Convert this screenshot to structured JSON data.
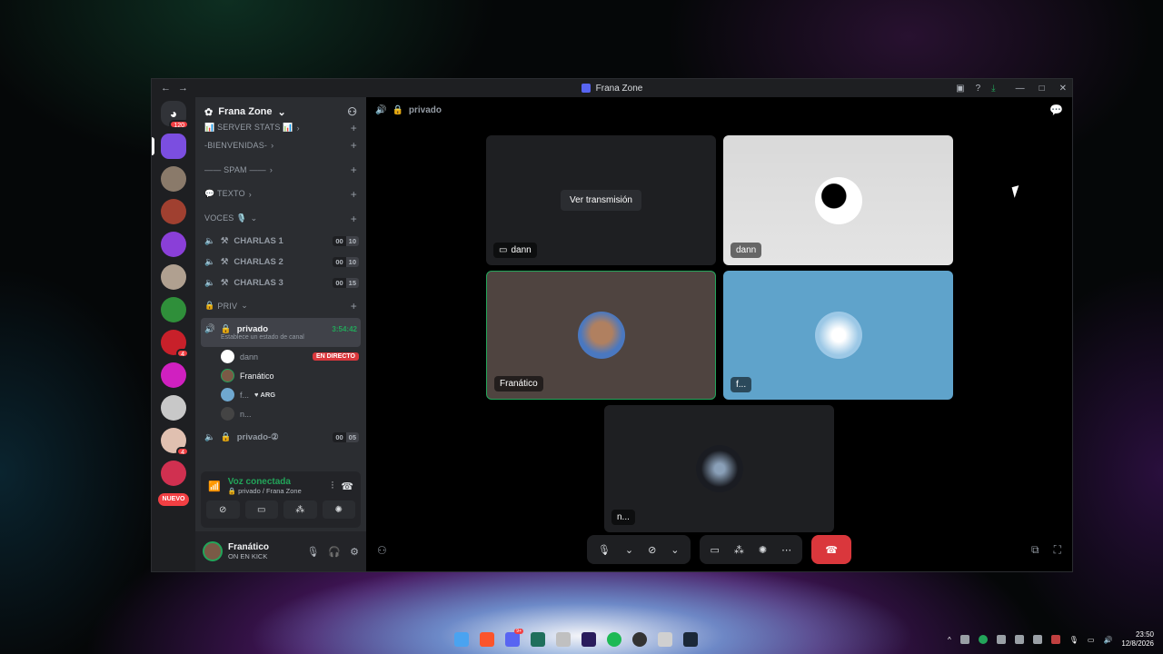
{
  "window": {
    "title": "Frana Zone",
    "nav_back": "←",
    "nav_forward": "→",
    "icons": [
      "inbox-icon",
      "help-icon",
      "download-icon"
    ],
    "minimize": "—",
    "maximize": "□",
    "close": "✕"
  },
  "servers": {
    "dm_badge": "120",
    "items": [
      {
        "name": "frana-zone",
        "color": "#7b4ee0",
        "badge": ""
      },
      {
        "name": "server-2",
        "color": "#8a7a6a",
        "badge": ""
      },
      {
        "name": "server-3",
        "color": "#a04030",
        "badge": ""
      },
      {
        "name": "server-4",
        "color": "#8a3fd8",
        "badge": ""
      },
      {
        "name": "server-5",
        "color": "#b0a090",
        "badge": ""
      },
      {
        "name": "server-6",
        "color": "#2f8f3a",
        "badge": ""
      },
      {
        "name": "server-7",
        "color": "#c8202a",
        "badge": "4"
      },
      {
        "name": "server-8",
        "color": "#d020c0",
        "badge": ""
      },
      {
        "name": "server-9",
        "color": "#c8c8c8",
        "badge": ""
      },
      {
        "name": "server-10",
        "color": "#e0c0b0",
        "badge": "4"
      },
      {
        "name": "server-11",
        "color": "#d03050",
        "badge": ""
      }
    ],
    "new_label": "NUEVO"
  },
  "guild": {
    "name": "Frana Zone",
    "categories": [
      {
        "label": "📊 SERVER STATS 📊"
      },
      {
        "label": "-BIENVENIDAS-"
      },
      {
        "label": "—— SPAM ——"
      },
      {
        "label": "💬 TEXTO"
      },
      {
        "label": "VOCES 🎙️"
      }
    ],
    "voice_channels": [
      {
        "name": "CHARLAS 1",
        "count_a": "00",
        "count_b": "10"
      },
      {
        "name": "CHARLAS 2",
        "count_a": "00",
        "count_b": "10"
      },
      {
        "name": "CHARLAS 3",
        "count_a": "00",
        "count_b": "15"
      }
    ],
    "priv_category": "PRIV",
    "active_channel": {
      "name": "privado",
      "timer": "3:54:42",
      "status": "Establece un estado de canal"
    },
    "members": [
      {
        "name": "dann",
        "live": "EN DIRECTO"
      },
      {
        "name": "Franático",
        "live": ""
      },
      {
        "name": "f...",
        "tag": "ARG"
      },
      {
        "name": "n...",
        "live": ""
      }
    ],
    "other_channel": {
      "name": "privado-②",
      "count_a": "00",
      "count_b": "05"
    }
  },
  "voice_panel": {
    "status": "Voz conectada",
    "location": "privado / Frana Zone"
  },
  "user": {
    "name": "Franático",
    "status": "ON EN KICK"
  },
  "stage": {
    "channel": "privado",
    "tiles": [
      {
        "label": "dann",
        "button": "Ver transmisión"
      },
      {
        "label": "dann"
      },
      {
        "label": "Franático"
      },
      {
        "label": "f..."
      },
      {
        "label": "n..."
      }
    ]
  },
  "taskbar": {
    "time": "23:50",
    "date": "12/8/2026",
    "discord_badge": "9+"
  },
  "colors": {
    "accent": "#5865f2",
    "green": "#23a55a",
    "red": "#da373c"
  }
}
